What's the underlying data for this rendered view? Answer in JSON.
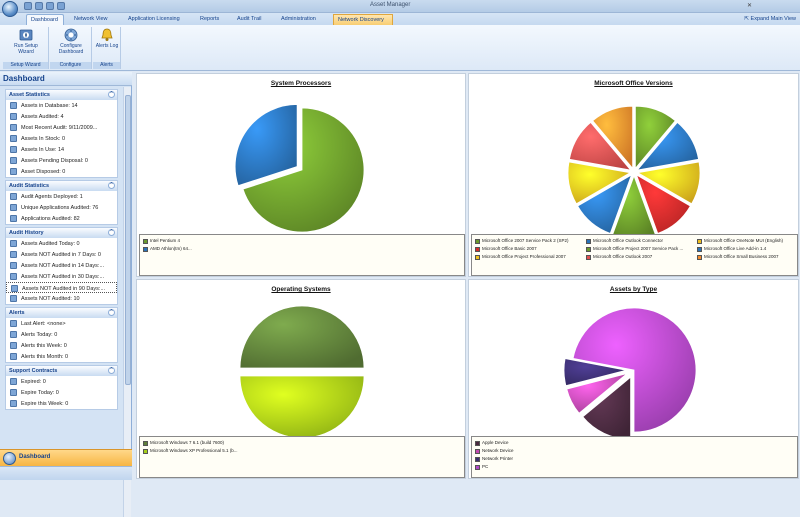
{
  "window": {
    "title": "Asset Manager",
    "right_action": "Expand Main View"
  },
  "tabs": [
    {
      "label": "Dashboard",
      "active": true
    },
    {
      "label": "Network View"
    },
    {
      "label": "Application Licensing"
    },
    {
      "label": "Reports"
    },
    {
      "label": "Audit Trail"
    },
    {
      "label": "Administration"
    },
    {
      "label": "Network Discovery",
      "contextual": true
    }
  ],
  "ribbon": {
    "groups": [
      {
        "label": "Setup Wizard",
        "buttons": [
          {
            "label": "Run Setup Wizard",
            "icon": "wizard-icon"
          }
        ]
      },
      {
        "label": "Configure",
        "buttons": [
          {
            "label": "Configure Dashboard",
            "icon": "configure-dashboard-icon"
          }
        ]
      },
      {
        "label": "Alerts",
        "buttons": [
          {
            "label": "Alerts Log",
            "icon": "alerts-log-icon"
          }
        ]
      }
    ]
  },
  "sidebar": {
    "header": "Dashboard",
    "sections": [
      {
        "title": "Asset Statistics",
        "items": [
          "Assets in Database: 14",
          "Assets Audited: 4",
          "Most Recent Audit: 9/11/2009...",
          "Assets In Stock: 0",
          "Assets In Use: 14",
          "Assets Pending Disposal: 0",
          "Asset Disposed: 0"
        ]
      },
      {
        "title": "Audit Statistics",
        "items": [
          "Audit Agents Deployed: 1",
          "Unique Applications Audited: 76",
          "Applications Audited: 82"
        ]
      },
      {
        "title": "Audit History",
        "items": [
          "Assets Audited Today: 0",
          "Assets NOT Audited in 7 Days: 0",
          "Assets NOT Audited in 14 Days:...",
          "Assets NOT Audited in 30 Days:...",
          "Assets NOT Audited in 90 Days:...",
          "Assets NOT Audited: 10"
        ],
        "selected_index": 4
      },
      {
        "title": "Alerts",
        "items": [
          "Last Alert: <none>",
          "Alerts Today: 0",
          "Alerts this Week: 0",
          "Alerts this Month: 0"
        ]
      },
      {
        "title": "Support Contracts",
        "items": [
          "Expired: 0",
          "Expire Today: 0",
          "Expire this Week: 0"
        ]
      }
    ],
    "nav_button": "Dashboard"
  },
  "charts": [
    {
      "title": "System Processors",
      "chart_data": {
        "type": "pie",
        "categories": [
          "Intel Pentium 4",
          "AMD Athlon(tm) 64..."
        ],
        "values": [
          70,
          30
        ]
      },
      "colors": [
        "#6b9a2c",
        "#2a72b8"
      ],
      "legend": [
        "Intel Pentium 4",
        "AMD Athlon(tm) 64..."
      ]
    },
    {
      "title": "Microsoft Office Versions",
      "chart_data": {
        "type": "pie",
        "categories": [
          "Microsoft Office 2007 Service Pack 2 (SP2)",
          "Microsoft Office Outlook Connector",
          "Microsoft Office OneNote MUI (English)",
          "Microsoft Office Basic 2007",
          "Microsoft Office Project 2007 Service Pack ...",
          "Microsoft Office Live Add-in 1.4",
          "Microsoft Office Project Professional 2007",
          "Microsoft Office Outlook 2007",
          "Microsoft Office Small Business 2007"
        ],
        "values": [
          1,
          1,
          1,
          1,
          1,
          1,
          1,
          1,
          1
        ]
      },
      "colors": [
        "#6b9a2c",
        "#2a72b8",
        "#f0c020",
        "#d62a2a",
        "#6b9a2c",
        "#2a72b8",
        "#f0c020",
        "#e05050",
        "#f48c2e"
      ],
      "legend": [
        "Microsoft Office 2007 Service Pack 2 (SP2)",
        "Microsoft Office Outlook Connector",
        "Microsoft Office OneNote MUI (English)",
        "Microsoft Office Basic 2007",
        "Microsoft Office Project 2007 Service Pack ...",
        "Microsoft Office Live Add-in 1.4",
        "Microsoft Office Project Professional 2007",
        "Microsoft Office Outlook 2007",
        "Microsoft Office Small Business 2007"
      ]
    },
    {
      "title": "Operating Systems",
      "chart_data": {
        "type": "pie",
        "categories": [
          "Microsoft Windows 7 6.1 (build 7600)",
          "Microsoft Windows XP Professional 5.1 (b..."
        ],
        "values": [
          50,
          50
        ]
      },
      "colors": [
        "#5e7f3a",
        "#a6cf18"
      ],
      "legend": [
        "Microsoft Windows 7 6.1 (build 7600)",
        "Microsoft Windows XP Professional 5.1 (b..."
      ]
    },
    {
      "title": "Assets by Type",
      "chart_data": {
        "type": "pie",
        "categories": [
          "Apple Device",
          "Network Device",
          "Network Printer",
          "PC"
        ],
        "values": [
          14,
          7,
          7,
          72
        ]
      },
      "colors": [
        "#4a2a40",
        "#c24ab0",
        "#3b2f70",
        "#b048c8"
      ],
      "legend": [
        "Apple Device",
        "Network Device",
        "Network Printer",
        "PC"
      ]
    }
  ]
}
